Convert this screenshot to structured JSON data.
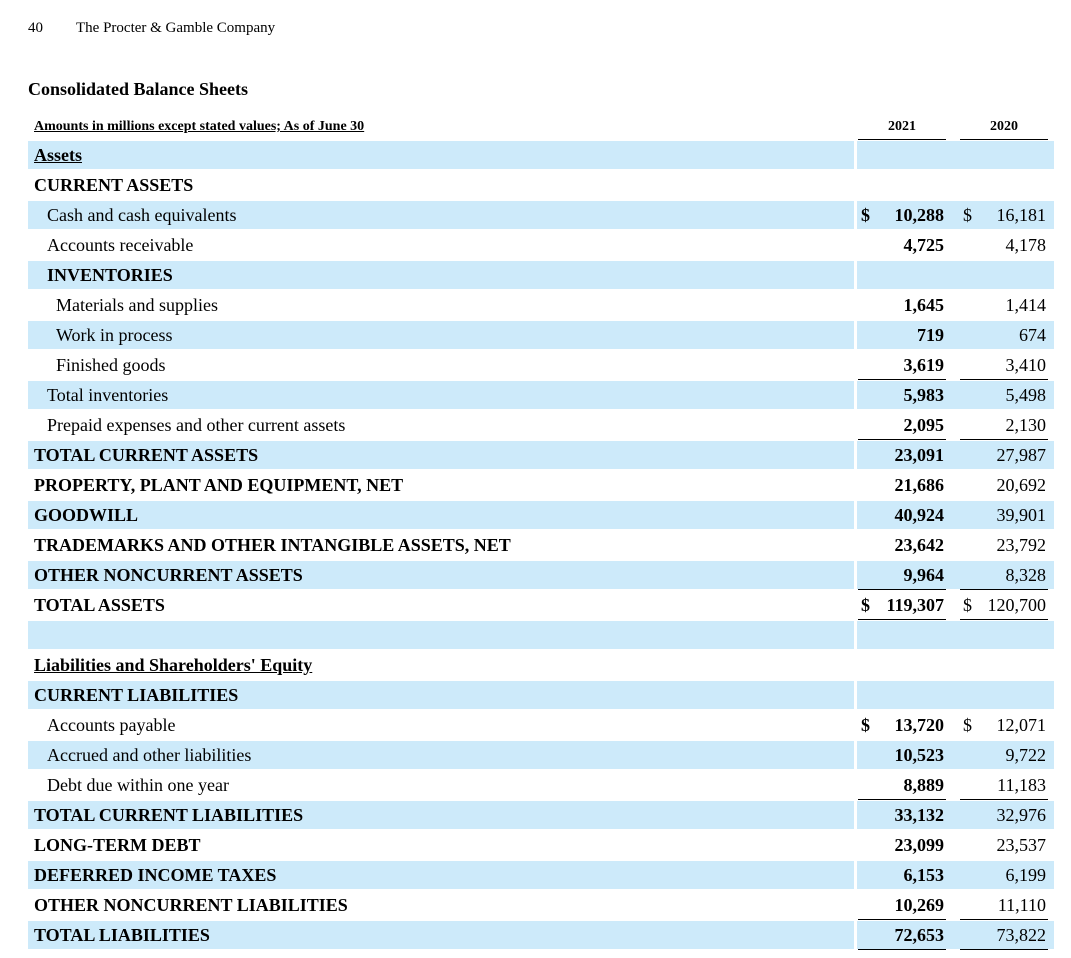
{
  "header": {
    "page_number": "40",
    "company": "The Procter & Gamble Company"
  },
  "title": "Consolidated Balance Sheets",
  "table": {
    "caption": "Amounts in millions except stated values; As of June 30",
    "year_2021": "2021",
    "year_2020": "2020",
    "rows": [
      {
        "label": "Assets",
        "style": "section"
      },
      {
        "label": "CURRENT ASSETS",
        "style": "caps0"
      },
      {
        "label": "Cash and cash equivalents",
        "style": "lv1",
        "v2021": "10,288",
        "v2020": "16,181",
        "dollar": true
      },
      {
        "label": "Accounts receivable",
        "style": "lv1",
        "v2021": "4,725",
        "v2020": "4,178"
      },
      {
        "label": "INVENTORIES",
        "style": "caps1"
      },
      {
        "label": "Materials and supplies",
        "style": "lv2",
        "v2021": "1,645",
        "v2020": "1,414"
      },
      {
        "label": "Work in process",
        "style": "lv2",
        "v2021": "719",
        "v2020": "674"
      },
      {
        "label": "Finished goods",
        "style": "lv2",
        "v2021": "3,619",
        "v2020": "3,410",
        "ul": "single"
      },
      {
        "label": "Total inventories",
        "style": "lv1",
        "v2021": "5,983",
        "v2020": "5,498"
      },
      {
        "label": "Prepaid expenses and other current assets",
        "style": "lv1",
        "v2021": "2,095",
        "v2020": "2,130",
        "ul": "single"
      },
      {
        "label": "TOTAL CURRENT ASSETS",
        "style": "caps0",
        "v2021": "23,091",
        "v2020": "27,987"
      },
      {
        "label": "PROPERTY, PLANT AND EQUIPMENT, NET",
        "style": "caps0",
        "v2021": "21,686",
        "v2020": "20,692"
      },
      {
        "label": "GOODWILL",
        "style": "caps0",
        "v2021": "40,924",
        "v2020": "39,901"
      },
      {
        "label": "TRADEMARKS AND OTHER INTANGIBLE ASSETS, NET",
        "style": "caps0",
        "v2021": "23,642",
        "v2020": "23,792"
      },
      {
        "label": "OTHER NONCURRENT ASSETS",
        "style": "caps0",
        "v2021": "9,964",
        "v2020": "8,328",
        "ul": "single"
      },
      {
        "label": "TOTAL ASSETS",
        "style": "caps0",
        "v2021": "119,307",
        "v2020": "120,700",
        "dollar": true,
        "ul": "double"
      },
      {
        "label": "",
        "style": "blank"
      },
      {
        "label": "Liabilities and Shareholders' Equity",
        "style": "section"
      },
      {
        "label": "CURRENT LIABILITIES",
        "style": "caps0"
      },
      {
        "label": "Accounts payable",
        "style": "lv1",
        "v2021": "13,720",
        "v2020": "12,071",
        "dollar": true
      },
      {
        "label": "Accrued and other liabilities",
        "style": "lv1",
        "v2021": "10,523",
        "v2020": "9,722"
      },
      {
        "label": "Debt due within one year",
        "style": "lv1",
        "v2021": "8,889",
        "v2020": "11,183",
        "ul": "single"
      },
      {
        "label": "TOTAL CURRENT LIABILITIES",
        "style": "caps0",
        "v2021": "33,132",
        "v2020": "32,976"
      },
      {
        "label": "LONG-TERM DEBT",
        "style": "caps0",
        "v2021": "23,099",
        "v2020": "23,537"
      },
      {
        "label": "DEFERRED INCOME TAXES",
        "style": "caps0",
        "v2021": "6,153",
        "v2020": "6,199"
      },
      {
        "label": "OTHER NONCURRENT LIABILITIES",
        "style": "caps0",
        "v2021": "10,269",
        "v2020": "11,110",
        "ul": "single"
      },
      {
        "label": "TOTAL LIABILITIES",
        "style": "caps0",
        "v2021": "72,653",
        "v2020": "73,822",
        "ul": "single"
      }
    ]
  }
}
